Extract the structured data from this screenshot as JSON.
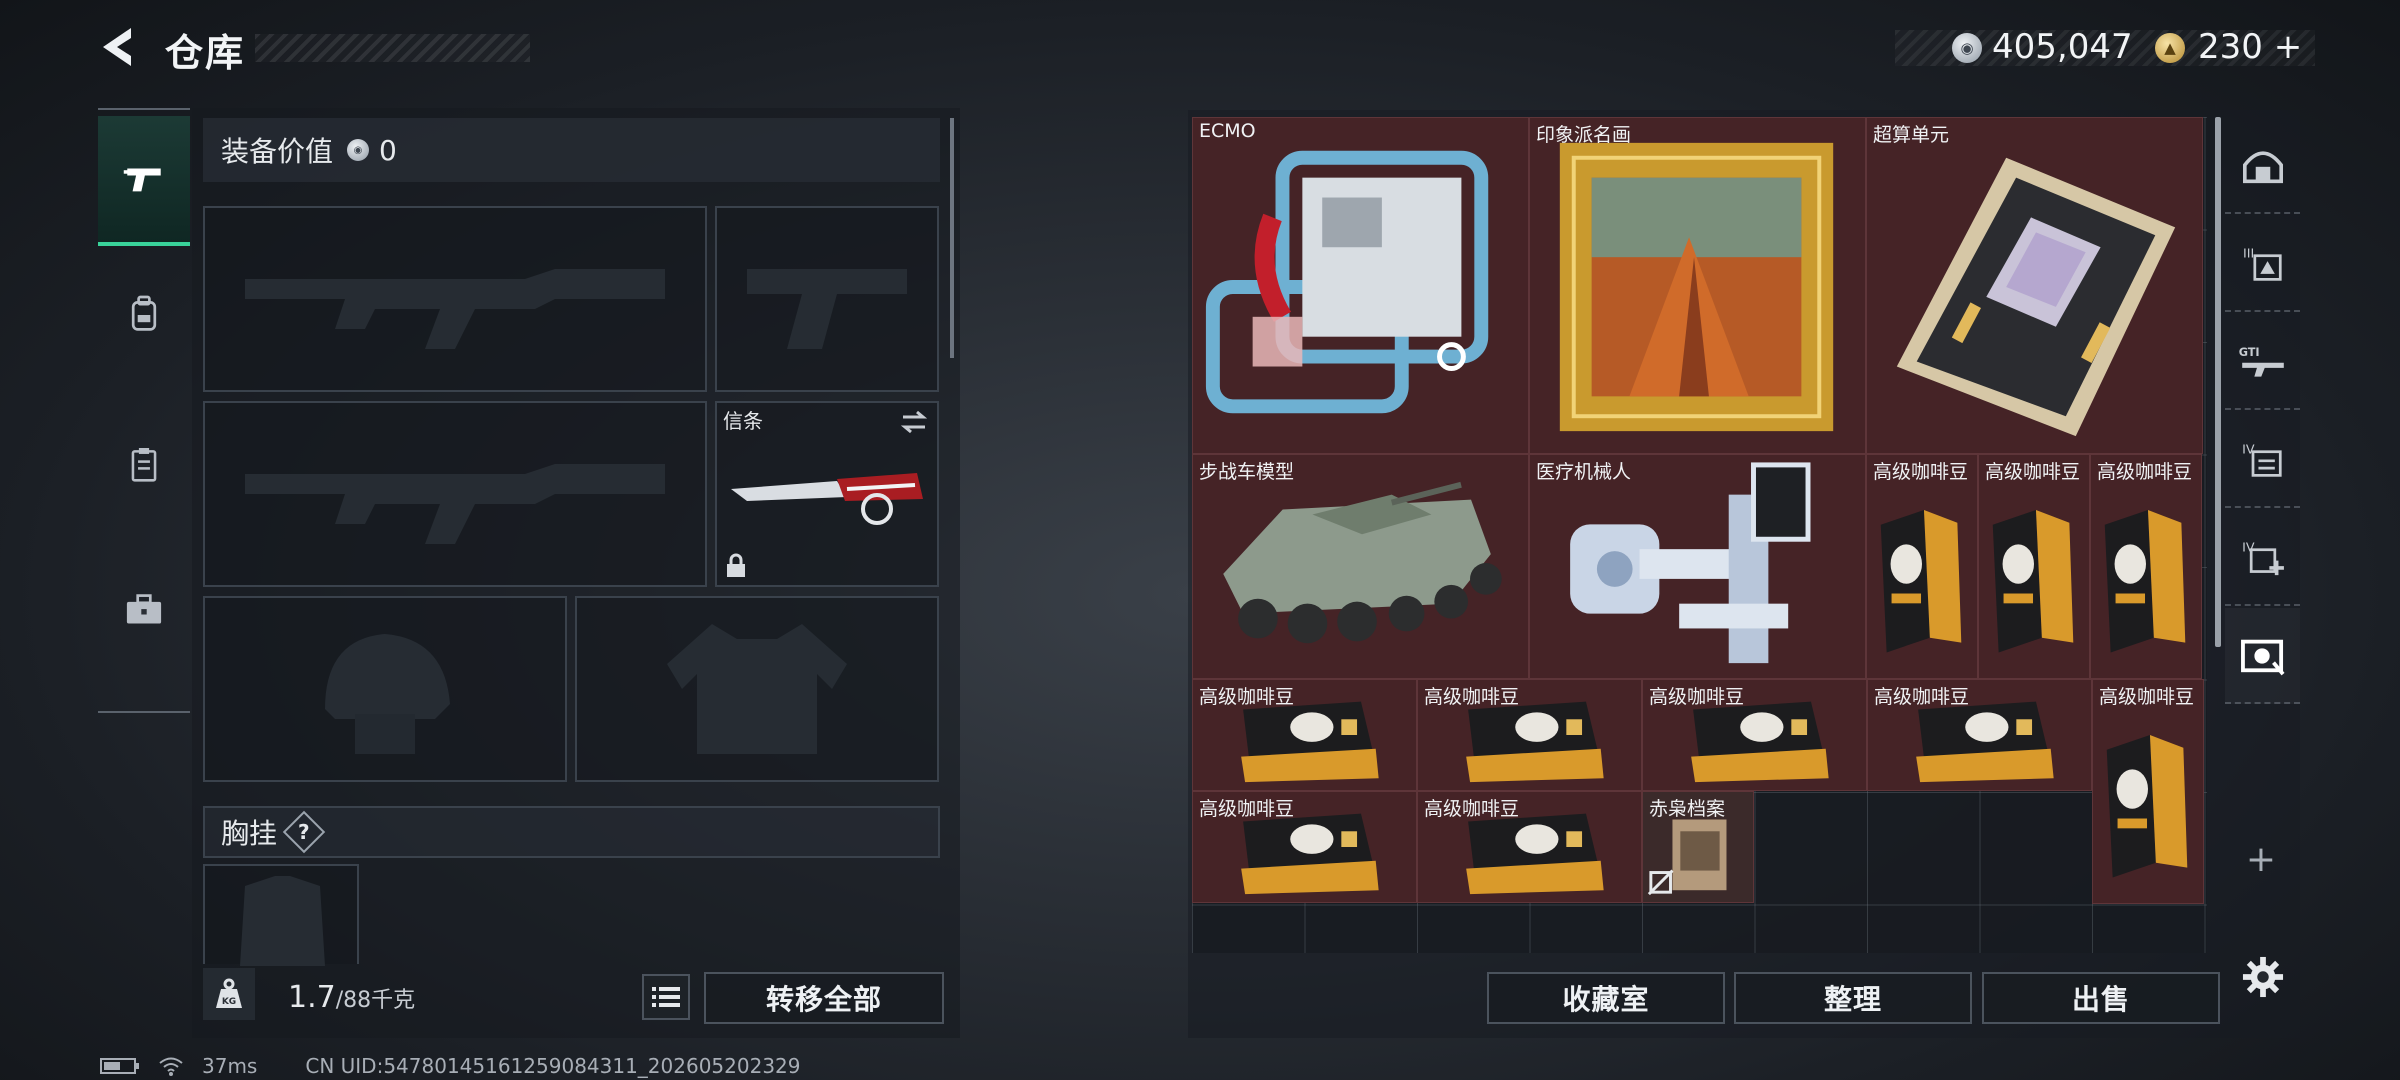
{
  "header": {
    "title": "仓库",
    "currency_silver": "405,047",
    "currency_gold": "230",
    "currency_gold_plus": "+"
  },
  "loadout": {
    "equip_value_label": "装备价值",
    "equip_value": "0",
    "melee_label": "信条",
    "chest_label": "胸挂",
    "chest_help": "?",
    "weight_current": "1.7",
    "weight_max": "/88千克",
    "weight_icon_text": "KG",
    "transfer_all": "转移全部"
  },
  "status": {
    "ping": "37ms",
    "uid": "CN UID:54780145161259084311_202605202329"
  },
  "storage": {
    "items": [
      {
        "label": "ECMO"
      },
      {
        "label": "印象派名画"
      },
      {
        "label": "超算单元"
      },
      {
        "label": "步战车模型"
      },
      {
        "label": "医疗机械人"
      },
      {
        "label": "高级咖啡豆"
      },
      {
        "label": "高级咖啡豆"
      },
      {
        "label": "高级咖啡豆"
      },
      {
        "label": "高级咖啡豆"
      },
      {
        "label": "高级咖啡豆"
      },
      {
        "label": "高级咖啡豆"
      },
      {
        "label": "高级咖啡豆"
      },
      {
        "label": "高级咖啡豆"
      },
      {
        "label": "高级咖啡豆"
      },
      {
        "label": "高级咖啡豆"
      },
      {
        "label": "赤枭档案"
      }
    ],
    "collection_btn": "收藏室",
    "sort_btn": "整理",
    "sell_btn": "出售",
    "add_tab": "+"
  },
  "colors": {
    "accent": "#39d39a",
    "item_bg": "#452326",
    "coffee_gold": "#d99a2b"
  }
}
